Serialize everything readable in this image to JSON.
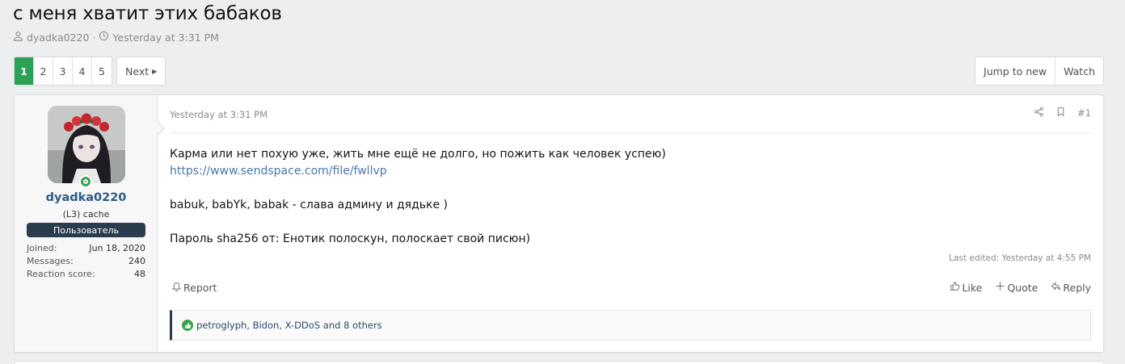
{
  "thread": {
    "title": "с меня хватит этих бабаков",
    "author": "dyadka0220",
    "separator": "·",
    "date": "Yesterday at 3:31 PM"
  },
  "pagination": {
    "pages": [
      "1",
      "2",
      "3",
      "4",
      "5"
    ],
    "current": "1",
    "next_label": "Next"
  },
  "thread_actions": {
    "jump_label": "Jump to new",
    "watch_label": "Watch"
  },
  "post": {
    "user": {
      "name": "dyadka0220",
      "title": "(L3) cache",
      "banner": "Пользователь",
      "stats": [
        {
          "label": "Joined:",
          "value": "Jun 18, 2020"
        },
        {
          "label": "Messages:",
          "value": "240"
        },
        {
          "label": "Reaction score:",
          "value": "48"
        }
      ]
    },
    "date": "Yesterday at 3:31 PM",
    "number": "#1",
    "body": {
      "line1": "Карма или нет похую уже, жить мне ещё не долго, но пожить как человек успею)",
      "link": "https://www.sendspace.com/file/fwllvp",
      "line2": "babuk, babYk, babak - слава админу и дядьке )",
      "line3": "Пароль sha256 от: Енотик полоскун, полоскает свой писюн)"
    },
    "last_edited": "Last edited: Yesterday at 4:55 PM",
    "report_label": "Report",
    "like_label": "Like",
    "quote_label": "Quote",
    "reply_label": "Reply",
    "reactions_text": "petroglyph, Bidon, X-DDoS and 8 others"
  },
  "colors": {
    "accent_green": "#2aa155",
    "username_blue": "#2d5b87",
    "banner_bg": "#2b3c4e",
    "link": "#4a78a8"
  }
}
